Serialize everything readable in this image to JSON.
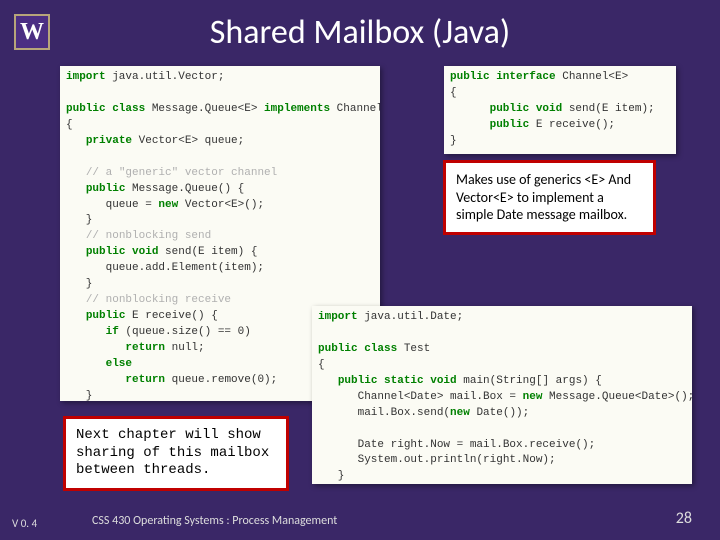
{
  "title": "Shared Mailbox (Java)",
  "logo": "W",
  "code_left_lines": [
    {
      "parts": [
        {
          "c": "kw",
          "t": "import"
        },
        {
          "c": "pl",
          "t": " java.util.Vector;"
        }
      ]
    },
    {
      "parts": []
    },
    {
      "parts": [
        {
          "c": "kw",
          "t": "public class"
        },
        {
          "c": "pl",
          "t": " Message.Queue<E> "
        },
        {
          "c": "kw",
          "t": "implements"
        },
        {
          "c": "pl",
          "t": " Channel<E>"
        }
      ]
    },
    {
      "parts": [
        {
          "c": "pl",
          "t": "{"
        }
      ]
    },
    {
      "parts": [
        {
          "c": "pl",
          "t": "   "
        },
        {
          "c": "kw",
          "t": "private"
        },
        {
          "c": "pl",
          "t": " Vector<E> queue;"
        }
      ]
    },
    {
      "parts": []
    },
    {
      "parts": [
        {
          "c": "pl",
          "t": "   "
        },
        {
          "c": "cm",
          "t": "// a \"generic\" vector channel"
        }
      ]
    },
    {
      "parts": [
        {
          "c": "pl",
          "t": "   "
        },
        {
          "c": "kw",
          "t": "public"
        },
        {
          "c": "pl",
          "t": " Message.Queue() {"
        }
      ]
    },
    {
      "parts": [
        {
          "c": "pl",
          "t": "      queue = "
        },
        {
          "c": "kw",
          "t": "new"
        },
        {
          "c": "pl",
          "t": " Vector<E>();"
        }
      ]
    },
    {
      "parts": [
        {
          "c": "pl",
          "t": "   }"
        }
      ]
    },
    {
      "parts": [
        {
          "c": "pl",
          "t": "   "
        },
        {
          "c": "cm",
          "t": "// nonblocking send"
        }
      ]
    },
    {
      "parts": [
        {
          "c": "pl",
          "t": "   "
        },
        {
          "c": "kw",
          "t": "public void"
        },
        {
          "c": "pl",
          "t": " send(E item) {"
        }
      ]
    },
    {
      "parts": [
        {
          "c": "pl",
          "t": "      queue.add.Element(item);"
        }
      ]
    },
    {
      "parts": [
        {
          "c": "pl",
          "t": "   }"
        }
      ]
    },
    {
      "parts": [
        {
          "c": "pl",
          "t": "   "
        },
        {
          "c": "cm",
          "t": "// nonblocking receive"
        }
      ]
    },
    {
      "parts": [
        {
          "c": "pl",
          "t": "   "
        },
        {
          "c": "kw",
          "t": "public"
        },
        {
          "c": "pl",
          "t": " E receive() {"
        }
      ]
    },
    {
      "parts": [
        {
          "c": "pl",
          "t": "      "
        },
        {
          "c": "kw",
          "t": "if"
        },
        {
          "c": "pl",
          "t": " (queue.size() == 0)"
        }
      ]
    },
    {
      "parts": [
        {
          "c": "pl",
          "t": "         "
        },
        {
          "c": "kw",
          "t": "return"
        },
        {
          "c": "pl",
          "t": " null;"
        }
      ]
    },
    {
      "parts": [
        {
          "c": "pl",
          "t": "      "
        },
        {
          "c": "kw",
          "t": "else"
        }
      ]
    },
    {
      "parts": [
        {
          "c": "pl",
          "t": "         "
        },
        {
          "c": "kw",
          "t": "return"
        },
        {
          "c": "pl",
          "t": " queue.remove(0);"
        }
      ]
    },
    {
      "parts": [
        {
          "c": "pl",
          "t": "   }"
        }
      ]
    },
    {
      "parts": [
        {
          "c": "pl",
          "t": "}"
        }
      ]
    }
  ],
  "code_right1_lines": [
    {
      "parts": [
        {
          "c": "kw",
          "t": "public interface"
        },
        {
          "c": "pl",
          "t": " Channel<E>"
        }
      ]
    },
    {
      "parts": [
        {
          "c": "pl",
          "t": "{"
        }
      ]
    },
    {
      "parts": [
        {
          "c": "pl",
          "t": "      "
        },
        {
          "c": "kw",
          "t": "public void"
        },
        {
          "c": "pl",
          "t": " send(E item);"
        }
      ]
    },
    {
      "parts": [
        {
          "c": "pl",
          "t": "      "
        },
        {
          "c": "kw",
          "t": "public"
        },
        {
          "c": "pl",
          "t": " E receive();"
        }
      ]
    },
    {
      "parts": [
        {
          "c": "pl",
          "t": "}"
        }
      ]
    }
  ],
  "code_right2_lines": [
    {
      "parts": [
        {
          "c": "kw",
          "t": "import"
        },
        {
          "c": "pl",
          "t": " java.util.Date;"
        }
      ]
    },
    {
      "parts": []
    },
    {
      "parts": [
        {
          "c": "kw",
          "t": "public class"
        },
        {
          "c": "pl",
          "t": " Test"
        }
      ]
    },
    {
      "parts": [
        {
          "c": "pl",
          "t": "{"
        }
      ]
    },
    {
      "parts": [
        {
          "c": "pl",
          "t": "   "
        },
        {
          "c": "kw",
          "t": "public static void"
        },
        {
          "c": "pl",
          "t": " main(String[] args) {"
        }
      ]
    },
    {
      "parts": [
        {
          "c": "pl",
          "t": "      Channel<Date> mail.Box = "
        },
        {
          "c": "kw",
          "t": "new"
        },
        {
          "c": "pl",
          "t": " Message.Queue<Date>();"
        }
      ]
    },
    {
      "parts": [
        {
          "c": "pl",
          "t": "      mail.Box.send("
        },
        {
          "c": "kw",
          "t": "new"
        },
        {
          "c": "pl",
          "t": " Date());"
        }
      ]
    },
    {
      "parts": []
    },
    {
      "parts": [
        {
          "c": "pl",
          "t": "      Date right.Now = mail.Box.receive();"
        }
      ]
    },
    {
      "parts": [
        {
          "c": "pl",
          "t": "      System.out.println(right.Now);"
        }
      ]
    },
    {
      "parts": [
        {
          "c": "pl",
          "t": "   }"
        }
      ]
    },
    {
      "parts": [
        {
          "c": "pl",
          "t": "}"
        }
      ]
    }
  ],
  "callout1": "Makes use of generics <E> And Vector<E> to implement a simple Date message mailbox.",
  "callout2": "Next chapter will show sharing of this mailbox between threads.",
  "footer_version": "V 0. 4",
  "footer_course": "CSS 430 Operating Systems : Process Management",
  "page_number": "28"
}
